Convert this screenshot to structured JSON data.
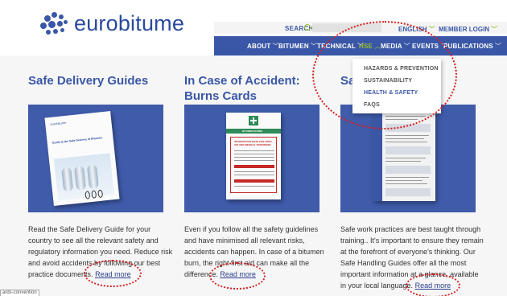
{
  "logo": {
    "text": "eurobitume"
  },
  "header": {
    "search_label": "SEARCH",
    "language": "ENGLISH",
    "member_login": "MEMBER LOGIN"
  },
  "nav": [
    {
      "label": "ABOUT",
      "active": false
    },
    {
      "label": "BITUMEN",
      "active": false
    },
    {
      "label": "TECHNICAL",
      "active": false
    },
    {
      "label": "HSE",
      "active": true
    },
    {
      "label": "MEDIA",
      "active": false
    },
    {
      "label": "EVENTS",
      "active": false
    },
    {
      "label": "PUBLICATIONS",
      "active": false
    }
  ],
  "dropdown": [
    {
      "label": "HAZARDS & PREVENTION",
      "active": false
    },
    {
      "label": "SUSTAINABILITY",
      "active": false
    },
    {
      "label": "HEALTH & SAFETY",
      "active": true
    },
    {
      "label": "FAQS",
      "active": false
    }
  ],
  "columns": [
    {
      "title": "Safe Delivery Guides",
      "doc_brand": "eurobitume",
      "doc_title": "Guide to the Safe Delivery of Bitumen",
      "text_lines": [
        "Read the Safe Delivery Guide for your",
        "country to see all the relevant safety and",
        "regulatory information you need. Reduce risk",
        "and avoid accidents by following our best",
        "practice documents."
      ],
      "read_more": "Read more"
    },
    {
      "title_line1": "In Case of Accident:",
      "title_line2": "Burns Cards",
      "doc_band": "BITUMEN BURNS",
      "doc_heading": "INFORMATION NOTE FOR FIRST AID AND MEDICAL PERSONNEL",
      "text_lines": [
        "Even if you follow all the safety guidelines",
        "and have minimised all relevant risks,",
        "accidents can happen. In case of a bitumen",
        "burn, the right first aid can make all the",
        "difference."
      ],
      "read_more": "Read more"
    },
    {
      "title": "Saf",
      "text_lines": [
        "Safe work practices are best taught through",
        "training.. It's important to ensure they remain",
        "at the forefront of everyone's thinking. Our",
        "Safe Handling Guides offer all the most",
        "important information at a glance, available",
        "in your local language."
      ],
      "read_more": "Read more"
    }
  ],
  "corner_tag": "ards-convention",
  "colors": {
    "brand_blue": "#3a57a7",
    "accent_green": "#9bbf2f",
    "annotation_red": "#d62020"
  }
}
